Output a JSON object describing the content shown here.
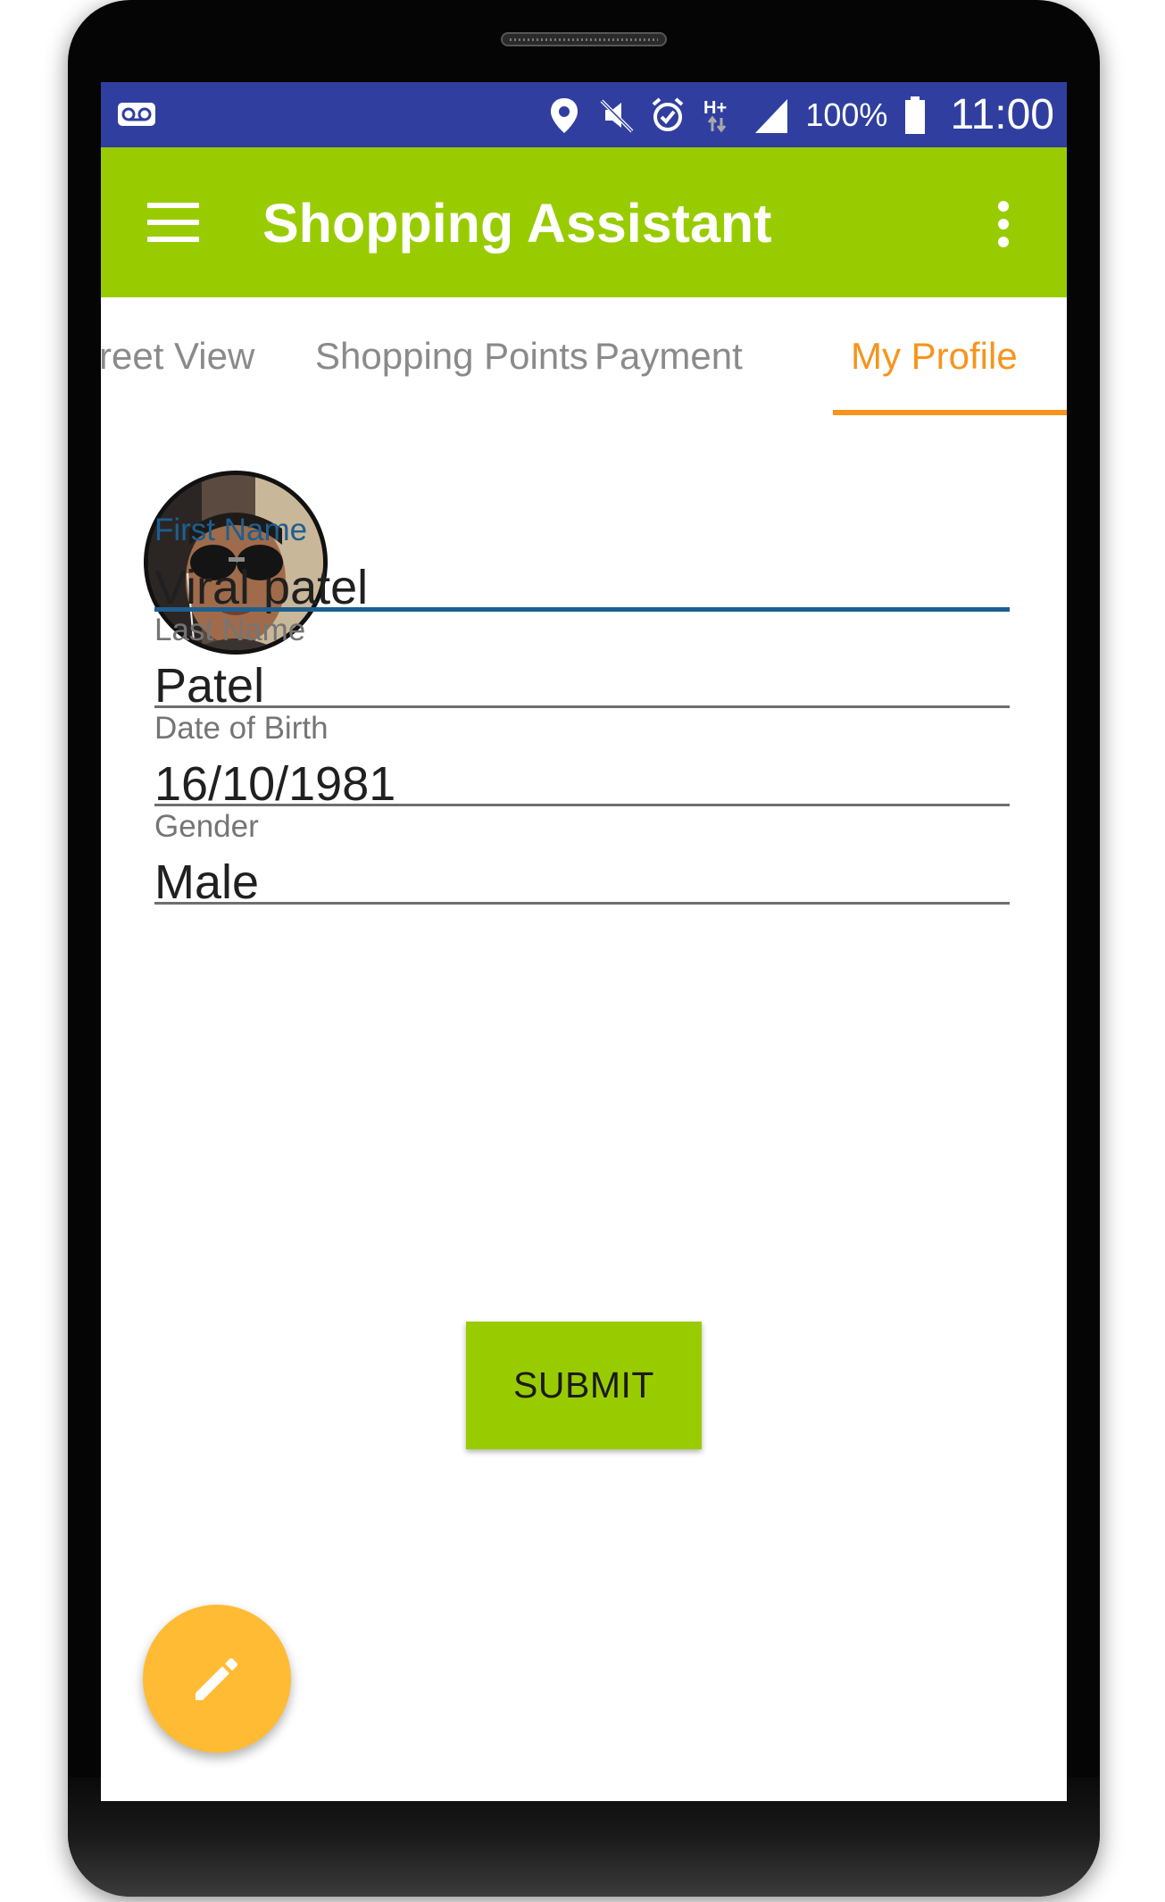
{
  "status_bar": {
    "icons": [
      "voicemail-icon",
      "location-pin-icon",
      "mute-icon",
      "alarm-icon",
      "network-hplus-icon",
      "signal-icon",
      "battery-icon"
    ],
    "network_type": "H+",
    "battery_percent": "100%",
    "time": "11:00",
    "background_color": "#303f9f"
  },
  "app_bar": {
    "title": "Shopping Assistant",
    "menu_icon": "hamburger-menu-icon",
    "overflow_icon": "more-vertical-icon",
    "background_color": "#99cc00"
  },
  "tabs": {
    "items": [
      {
        "label": "reet View",
        "active": false
      },
      {
        "label": "Shopping Points",
        "active": false
      },
      {
        "label": "Payment",
        "active": false
      },
      {
        "label": "My Profile",
        "active": true
      }
    ],
    "active_color": "#f7941d",
    "inactive_color": "#8a8a8a"
  },
  "profile": {
    "avatar": "profile-photo",
    "fields": [
      {
        "label": "First Name",
        "value": "Viral patel",
        "focused": true
      },
      {
        "label": "Last Name",
        "value": "Patel",
        "focused": false
      },
      {
        "label": "Date of Birth",
        "value": "16/10/1981",
        "focused": false
      },
      {
        "label": "Gender",
        "value": "Male",
        "focused": false
      }
    ],
    "focus_color": "#1d5f91"
  },
  "submit": {
    "label": "SUBMIT",
    "background_color": "#99cc00"
  },
  "fab": {
    "icon": "pencil-edit-icon",
    "background_color": "#ffbb33"
  }
}
